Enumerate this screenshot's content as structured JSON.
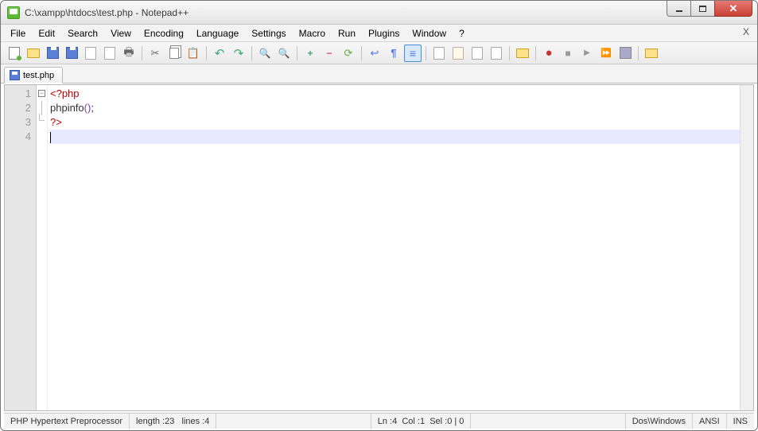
{
  "window": {
    "title": "C:\\xampp\\htdocs\\test.php - Notepad++"
  },
  "menu": {
    "items": [
      "File",
      "Edit",
      "Search",
      "View",
      "Encoding",
      "Language",
      "Settings",
      "Macro",
      "Run",
      "Plugins",
      "Window",
      "?"
    ],
    "close_doc": "X"
  },
  "toolbar": {
    "buttons": [
      {
        "name": "new-file-button",
        "icon": "ico-new relpos green-dot"
      },
      {
        "name": "open-file-button",
        "icon": "ico-open"
      },
      {
        "name": "save-button",
        "icon": "ico-save relpos"
      },
      {
        "name": "save-all-button",
        "icon": "ico-save relpos"
      },
      {
        "name": "close-button",
        "icon": "ico-f1"
      },
      {
        "name": "close-all-button",
        "icon": "ico-f1"
      },
      {
        "name": "print-button",
        "icon": "ico-print"
      },
      {
        "sep": true
      },
      {
        "name": "cut-button",
        "icon": "ico-cut"
      },
      {
        "name": "copy-button",
        "icon": "ico-copy"
      },
      {
        "name": "paste-button",
        "icon": "ico-paste"
      },
      {
        "sep": true
      },
      {
        "name": "undo-button",
        "icon": "ico-undo"
      },
      {
        "name": "redo-button",
        "icon": "ico-redo"
      },
      {
        "sep": true
      },
      {
        "name": "find-button",
        "icon": "ico-find"
      },
      {
        "name": "find-replace-button",
        "icon": "ico-findrep"
      },
      {
        "sep": true
      },
      {
        "name": "zoom-in-button",
        "icon": "ico-zoomin"
      },
      {
        "name": "zoom-out-button",
        "icon": "ico-zoomout"
      },
      {
        "name": "sync-vscroll-button",
        "icon": "ico-sync"
      },
      {
        "sep": true
      },
      {
        "name": "word-wrap-button",
        "icon": "ico-wrap"
      },
      {
        "name": "show-all-chars-button",
        "icon": "ico-para"
      },
      {
        "name": "indent-guide-button",
        "icon": "ico-indent",
        "selected": true
      },
      {
        "sep": true
      },
      {
        "name": "user-lang-button",
        "icon": "ico-f1"
      },
      {
        "name": "doc-map-button",
        "icon": "ico-f2"
      },
      {
        "name": "func-list-button",
        "icon": "ico-f1"
      },
      {
        "name": "folder-workspace-button",
        "icon": "ico-f1"
      },
      {
        "sep": true
      },
      {
        "name": "monitoring-button",
        "icon": "ico-folder"
      },
      {
        "sep": true
      },
      {
        "name": "record-macro-button",
        "icon": "ico-rec"
      },
      {
        "name": "stop-macro-button",
        "icon": "ico-stop"
      },
      {
        "name": "play-macro-button",
        "icon": "ico-play"
      },
      {
        "name": "run-macro-multi-button",
        "icon": "ico-ff"
      },
      {
        "name": "save-macro-button",
        "icon": "ico-savemac"
      },
      {
        "sep": true
      },
      {
        "name": "open-plugin-folder-button",
        "icon": "ico-folder"
      }
    ]
  },
  "tabs": {
    "items": [
      {
        "label": "test.php",
        "active": true
      }
    ]
  },
  "editor": {
    "lines": [
      {
        "n": "1",
        "fold": "box",
        "tokens": [
          {
            "t": "<?php",
            "c": "tok-tag"
          }
        ]
      },
      {
        "n": "2",
        "fold": "line",
        "tokens": [
          {
            "t": "phpinfo",
            "c": "tok-fn"
          },
          {
            "t": "()",
            "c": "tok-par"
          },
          {
            "t": ";",
            "c": "tok-sc"
          }
        ]
      },
      {
        "n": "3",
        "fold": "end",
        "tokens": [
          {
            "t": "?>",
            "c": "tok-tag"
          }
        ]
      },
      {
        "n": "4",
        "fold": "",
        "tokens": [],
        "current": true
      }
    ]
  },
  "status": {
    "lang": "PHP Hypertext Preprocessor",
    "length_label": "length : ",
    "length_value": "23",
    "lines_label": "lines : ",
    "lines_value": "4",
    "ln_label": "Ln : ",
    "ln_value": "4",
    "col_label": "Col : ",
    "col_value": "1",
    "sel_label": "Sel : ",
    "sel_value": "0 | 0",
    "eol": "Dos\\Windows",
    "encoding": "ANSI",
    "mode": "INS"
  }
}
